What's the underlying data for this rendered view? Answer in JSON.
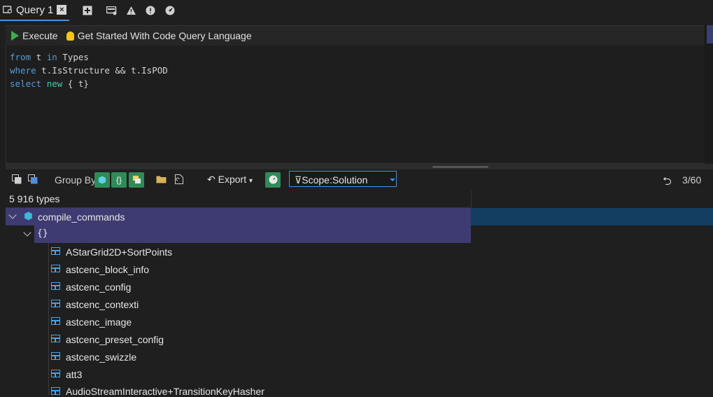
{
  "tab": {
    "title": "Query 1",
    "close": "×"
  },
  "toolbar": {
    "execute_label": "Execute",
    "get_started_label": "Get Started With Code Query Language"
  },
  "code": {
    "line1": {
      "k1": "from",
      "t1": " t ",
      "k2": "in",
      "t2": " Types"
    },
    "line2": {
      "k1": "where",
      "t1": " t.IsStructure && t.IsPOD"
    },
    "line3": {
      "k1": "select",
      "t1": " ",
      "k2": "new",
      "t2": " { t}"
    }
  },
  "results_toolbar": {
    "group_by_label": "Group By",
    "export_label": "Export",
    "scope_label": "Scope:Solution",
    "page_indicator": "3/60"
  },
  "results": {
    "count_label": "5 916 types",
    "root": "compile_commands",
    "namespace": "{}",
    "items": [
      "AStarGrid2D+SortPoints",
      "astcenc_block_info",
      "astcenc_config",
      "astcenc_contexti",
      "astcenc_image",
      "astcenc_preset_config",
      "astcenc_swizzle",
      "att3",
      "AudioStreamInteractive+TransitionKeyHasher"
    ]
  },
  "colors": {
    "accent": "#4f8ed8",
    "selected_row": "#3e3b72",
    "selected_row_full": "#143d62",
    "group_button": "#2e8b57",
    "execute_green": "#3fae4a"
  },
  "icons": [
    "query-icon",
    "close-icon",
    "add-icon",
    "database-icon",
    "warning-icon",
    "info-icon",
    "gauge-icon",
    "play-icon",
    "bulb-icon",
    "cube-icon",
    "braces-icon",
    "struct-icon",
    "folder-icon",
    "export-icon",
    "filter-icon",
    "back-icon"
  ]
}
